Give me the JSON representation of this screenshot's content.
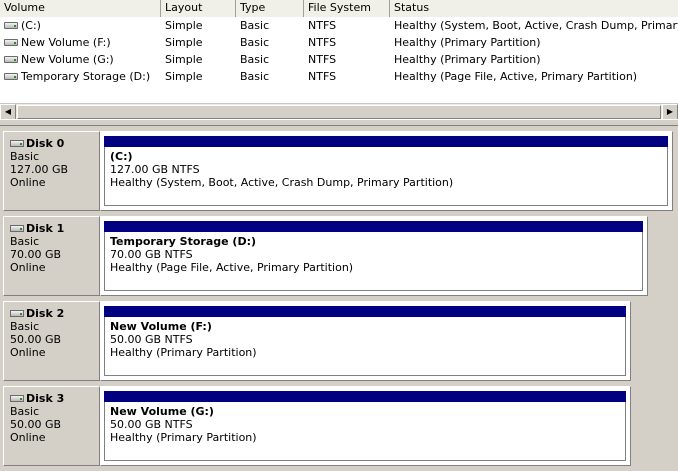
{
  "volume_list": {
    "columns": [
      "Volume",
      "Layout",
      "Type",
      "File System",
      "Status"
    ],
    "rows": [
      {
        "volume": " (C:)",
        "layout": "Simple",
        "type": "Basic",
        "fs": "NTFS",
        "status": "Healthy (System, Boot, Active, Crash Dump, Primary Pa..."
      },
      {
        "volume": "New Volume (F:)",
        "layout": "Simple",
        "type": "Basic",
        "fs": "NTFS",
        "status": "Healthy (Primary Partition)"
      },
      {
        "volume": "New Volume (G:)",
        "layout": "Simple",
        "type": "Basic",
        "fs": "NTFS",
        "status": "Healthy (Primary Partition)"
      },
      {
        "volume": "Temporary Storage (D:)",
        "layout": "Simple",
        "type": "Basic",
        "fs": "NTFS",
        "status": "Healthy (Page File, Active, Primary Partition)"
      }
    ]
  },
  "scrollbar": {
    "left_arrow": "◀",
    "right_arrow": "▶"
  },
  "disks": [
    {
      "name": "Disk 0",
      "type": "Basic",
      "size": "127.00 GB",
      "state": "Online",
      "partition": {
        "title": " (C:)",
        "size_fs": "127.00 GB NTFS",
        "status": "Healthy (System, Boot, Active, Crash Dump, Primary Partition)"
      }
    },
    {
      "name": "Disk 1",
      "type": "Basic",
      "size": "70.00 GB",
      "state": "Online",
      "partition": {
        "title": "Temporary Storage  (D:)",
        "size_fs": "70.00 GB NTFS",
        "status": "Healthy (Page File, Active, Primary Partition)"
      }
    },
    {
      "name": "Disk 2",
      "type": "Basic",
      "size": "50.00 GB",
      "state": "Online",
      "partition": {
        "title": "New Volume  (F:)",
        "size_fs": "50.00 GB NTFS",
        "status": "Healthy (Primary Partition)"
      }
    },
    {
      "name": "Disk 3",
      "type": "Basic",
      "size": "50.00 GB",
      "state": "Online",
      "partition": {
        "title": "New Volume  (G:)",
        "size_fs": "50.00 GB NTFS",
        "status": "Healthy (Primary Partition)"
      }
    }
  ]
}
